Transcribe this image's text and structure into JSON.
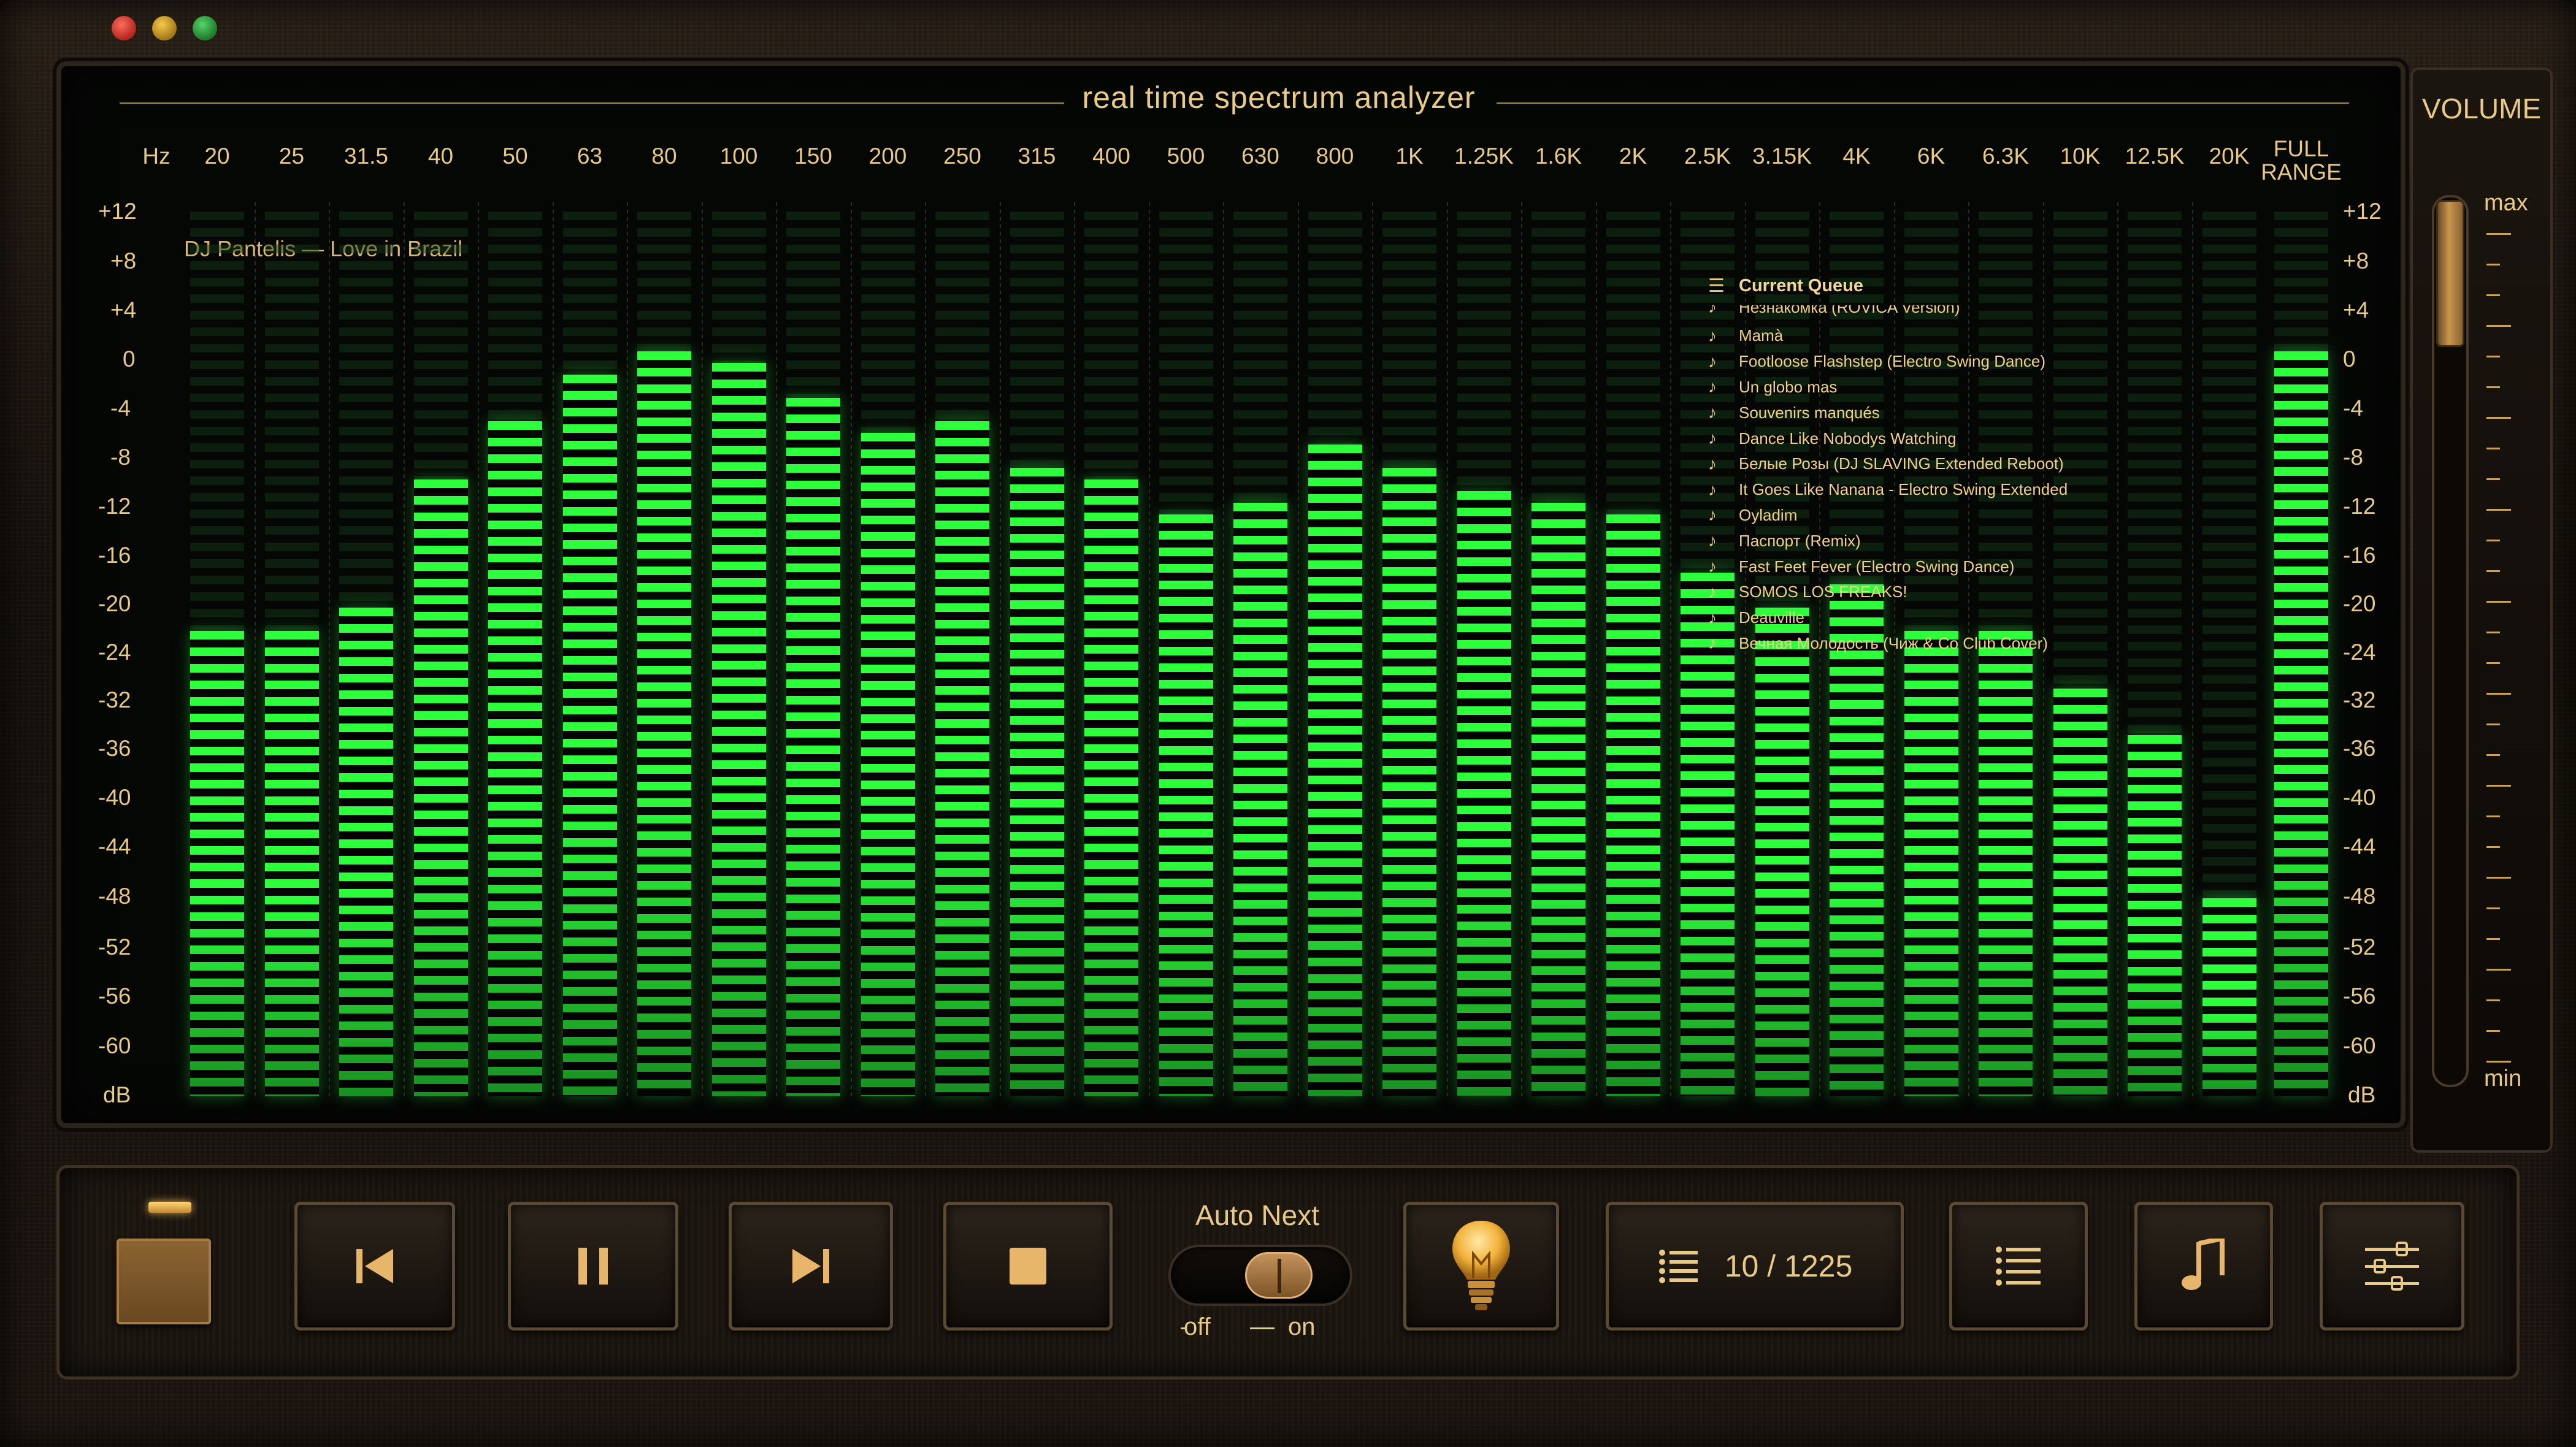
{
  "window": {
    "controls": [
      "close",
      "minimize",
      "zoom"
    ]
  },
  "analyzer": {
    "title": "real time spectrum analyzer",
    "unit_top": "Hz",
    "unit_bottom": "dB",
    "now_playing": "DJ Pantelis — Love in Brazil",
    "frequency_labels": [
      "20",
      "25",
      "31.5",
      "40",
      "50",
      "63",
      "80",
      "100",
      "150",
      "200",
      "250",
      "315",
      "400",
      "500",
      "630",
      "800",
      "1K",
      "1.25K",
      "1.6K",
      "2K",
      "2.5K",
      "3.15K",
      "4K",
      "6K",
      "6.3K",
      "10K",
      "12.5K",
      "20K"
    ],
    "full_range_label_1": "FULL",
    "full_range_label_2": "RANGE",
    "db_labels": [
      "+12",
      "+8",
      "+4",
      "0",
      "-4",
      "-8",
      "-12",
      "-16",
      "-20",
      "-24",
      "-32",
      "-36",
      "-40",
      "-44",
      "-48",
      "-52",
      "-56",
      "-60"
    ],
    "levels_db": [
      -24,
      -24,
      -22,
      -11,
      -6,
      -2,
      0,
      -1,
      -4,
      -7,
      -6,
      -10,
      -11,
      -14,
      -13,
      -8,
      -10,
      -12,
      -13,
      -14,
      -19,
      -22,
      -20,
      -24,
      -24,
      -29,
      -33,
      -47
    ],
    "full_range_level_db": 0,
    "accent_color": "#3cff4a",
    "label_color": "#e8c987"
  },
  "queue": {
    "title": "Current Queue",
    "items": [
      "Незнакомка (ROVICA Version)",
      "Mamà",
      "Footloose Flashstep (Electro Swing Dance)",
      "Un globo mas",
      "Souvenirs manqués",
      "Dance Like Nobodys Watching",
      "Белые Розы (DJ SLAVING Extended Reboot)",
      "It Goes Like Nanana - Electro Swing Extended",
      "Oyladim",
      "Паспорт (Remix)",
      "Fast Feet Fever (Electro Swing Dance)",
      "SOMOS LOS FREAKS!",
      "Deauville",
      "Вечная Молодость (Чиж & Co Club Cover)"
    ]
  },
  "volume": {
    "title": "VOLUME",
    "max_label": "max",
    "min_label": "min",
    "level": 1.0
  },
  "transport": {
    "auto_next_label": "Auto Next",
    "switch_off_label": "off",
    "switch_on_label": "on",
    "auto_next_state": "on",
    "counter": "10 / 1225"
  }
}
